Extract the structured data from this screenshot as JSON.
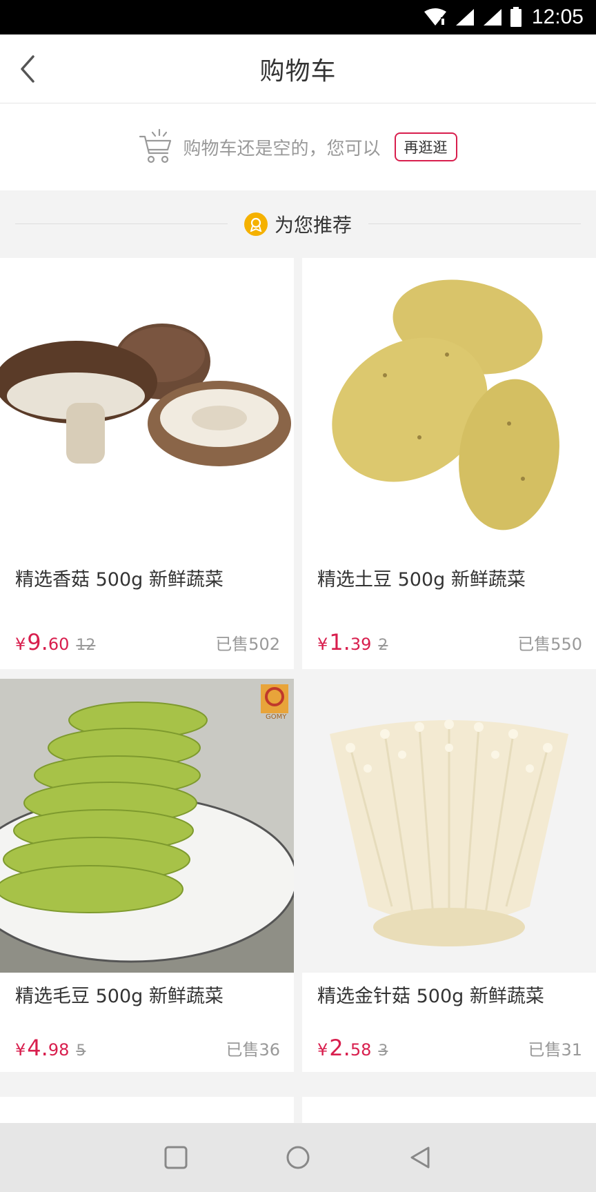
{
  "status_bar": {
    "time": "12:05"
  },
  "header": {
    "title": "购物车"
  },
  "empty_cart": {
    "message": "购物车还是空的，您可以",
    "browse_label": "再逛逛"
  },
  "recommend": {
    "title": "为您推荐"
  },
  "products": [
    {
      "name": "精选香菇 500g 新鲜蔬菜",
      "yen": "¥",
      "price_int": "9.",
      "price_dec": "60",
      "original": "12",
      "sold": "已售502"
    },
    {
      "name": "精选土豆 500g 新鲜蔬菜",
      "yen": "¥",
      "price_int": "1.",
      "price_dec": "39",
      "original": "2",
      "sold": "已售550"
    },
    {
      "name": "精选毛豆 500g 新鲜蔬菜",
      "yen": "¥",
      "price_int": "4.",
      "price_dec": "98",
      "original": "5",
      "sold": "已售36"
    },
    {
      "name": "精选金针菇 500g 新鲜蔬菜",
      "yen": "¥",
      "price_int": "2.",
      "price_dec": "58",
      "original": "3",
      "sold": "已售31"
    }
  ],
  "watermark_logo": "GOMY",
  "colors": {
    "accent": "#d81e4d",
    "badge": "#f5b100",
    "status_bar": "#000000"
  }
}
